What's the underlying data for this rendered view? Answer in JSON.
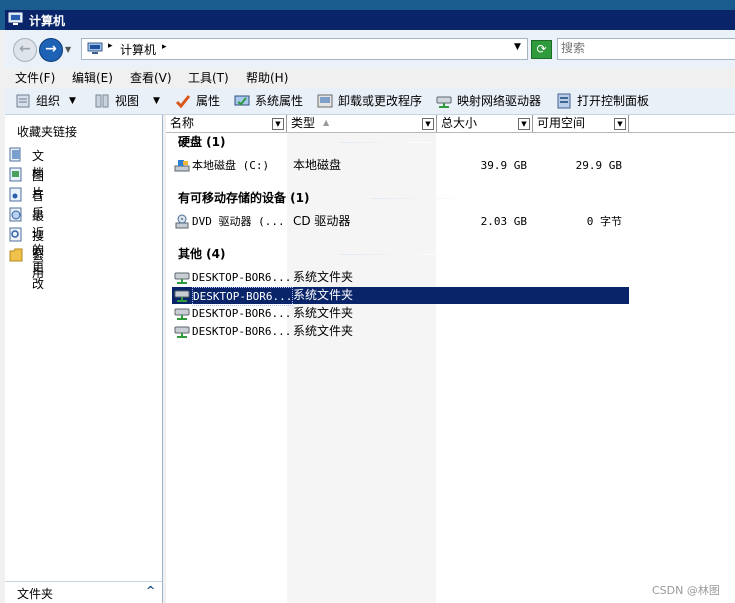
{
  "window": {
    "title": "计算机"
  },
  "address": {
    "crumb": "计算机",
    "search_placeholder": "搜索"
  },
  "menu": [
    {
      "label": "文件(F)",
      "name": "menu-file"
    },
    {
      "label": "编辑(E)",
      "name": "menu-edit"
    },
    {
      "label": "查看(V)",
      "name": "menu-view"
    },
    {
      "label": "工具(T)",
      "name": "menu-tools"
    },
    {
      "label": "帮助(H)",
      "name": "menu-help"
    }
  ],
  "toolbar": {
    "organize": "组织",
    "views": "视图",
    "properties": "属性",
    "system_properties": "系统属性",
    "uninstall": "卸载或更改程序",
    "map_drive": "映射网络驱动器",
    "control_panel": "打开控制面板"
  },
  "nav": {
    "favorites_title": "收藏夹链接",
    "items": [
      {
        "label": "文档",
        "icon": "documents-icon"
      },
      {
        "label": "图片",
        "icon": "pictures-icon"
      },
      {
        "label": "音乐",
        "icon": "music-icon"
      },
      {
        "label": "最近的更改",
        "icon": "recent-changes-icon"
      },
      {
        "label": "搜索",
        "icon": "search-icon"
      },
      {
        "label": "公用",
        "icon": "public-folder-icon"
      }
    ],
    "folders_label": "文件夹"
  },
  "columns": {
    "name": "名称",
    "type": "类型",
    "total_size": "总大小",
    "free_space": "可用空间"
  },
  "groups": {
    "hard_disks": {
      "title": "硬盘 (1)",
      "items": [
        {
          "name": "本地磁盘 (C:)",
          "type": "本地磁盘",
          "total": "39.9 GB",
          "free": "29.9 GB"
        }
      ]
    },
    "removable": {
      "title": "有可移动存储的设备 (1)",
      "items": [
        {
          "name": "DVD 驱动器 (...",
          "type": "CD 驱动器",
          "total": "2.03 GB",
          "free": "0 字节"
        }
      ]
    },
    "other": {
      "title": "其他 (4)",
      "items": [
        {
          "name": "DESKTOP-BOR6...",
          "type": "系统文件夹"
        },
        {
          "name": "DESKTOP-BOR6...",
          "type": "系统文件夹"
        },
        {
          "name": "DESKTOP-BOR6...",
          "type": "系统文件夹"
        },
        {
          "name": "DESKTOP-BOR6...",
          "type": "系统文件夹"
        }
      ]
    }
  },
  "selected_row": "other.1",
  "colors": {
    "selection": "#0a246a",
    "titlebar": "#0a246a"
  },
  "watermark": "CSDN @林图"
}
